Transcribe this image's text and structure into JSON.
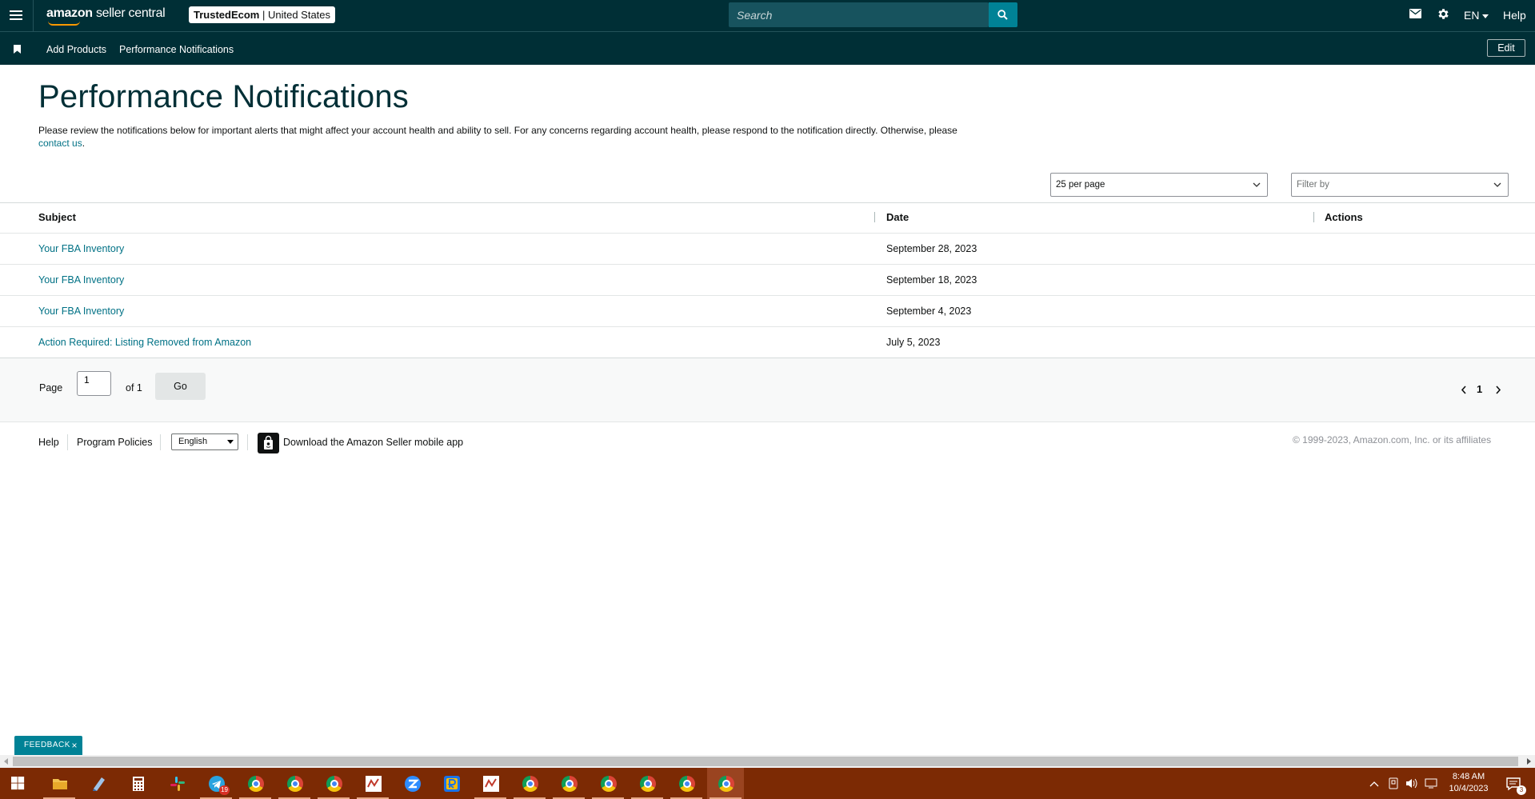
{
  "colors": {
    "nav_bg": "#002f36",
    "accent": "#008296",
    "link": "#007185",
    "taskbar": "#7c2a04"
  },
  "topnav": {
    "logo_brand": "amazon",
    "logo_product": "seller central",
    "store_name": "TrustedEcom",
    "store_region": "United States",
    "search_placeholder": "Search",
    "language": "EN",
    "help": "Help",
    "icons": [
      "menu-icon",
      "search-icon",
      "mail-icon",
      "gear-icon"
    ]
  },
  "subnav": {
    "links": [
      "Add Products",
      "Performance Notifications"
    ],
    "edit_label": "Edit"
  },
  "page": {
    "title": "Performance Notifications",
    "intro": "Please review the notifications below for important alerts that might affect your account health and ability to sell. For any concerns regarding account health, please respond to the notification directly. Otherwise, please",
    "contact_link": "contact us",
    "intro_end": "."
  },
  "controls": {
    "per_page": "25 per page",
    "filter_placeholder": "Filter by"
  },
  "table": {
    "columns": [
      "Subject",
      "Date",
      "Actions"
    ],
    "rows": [
      {
        "subject": "Your FBA Inventory",
        "date": "September 28, 2023"
      },
      {
        "subject": "Your FBA Inventory",
        "date": "September 18, 2023"
      },
      {
        "subject": "Your FBA Inventory",
        "date": "September 4, 2023"
      },
      {
        "subject": "Action Required: Listing Removed from Amazon",
        "date": "July 5, 2023"
      }
    ]
  },
  "pagination": {
    "page_label": "Page",
    "page_value": "1",
    "of_label": "of 1",
    "go_label": "Go",
    "current_page": "1"
  },
  "footer": {
    "help": "Help",
    "program_policies": "Program Policies",
    "language": "English",
    "app_link": "Download the Amazon Seller mobile app",
    "copyright": "© 1999-2023, Amazon.com, Inc. or its affiliates"
  },
  "feedback": {
    "label": "FEEDBACK",
    "close": "×"
  },
  "taskbar": {
    "telegram_badge": "19",
    "notification_badge": "3",
    "time": "8:48 AM",
    "date": "10/4/2023"
  }
}
